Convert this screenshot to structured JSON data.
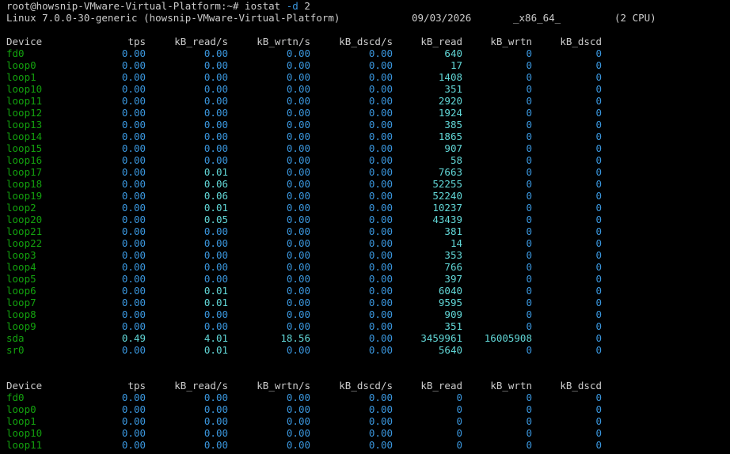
{
  "colors": {
    "background": "#000000",
    "text": "#cccccc",
    "device": "#13a10e",
    "value": "#3a96dd",
    "value_bright": "#61d6d6"
  },
  "prompt": {
    "user_host": "root@howsnip-VMware-Virtual-Platform",
    "path": ":~#",
    "command": "iostat",
    "option": "-d",
    "argument": "2"
  },
  "sysinfo": {
    "kernel": "Linux 7.0.0-30-generic (howsnip-VMware-Virtual-Platform)",
    "date": "09/03/2026",
    "arch": "_x86_64_",
    "cpus": "(2 CPU)"
  },
  "headers": [
    "Device",
    "tps",
    "kB_read/s",
    "kB_wrtn/s",
    "kB_dscd/s",
    "kB_read",
    "kB_wrtn",
    "kB_dscd"
  ],
  "report1": [
    [
      "fd0",
      "0.00",
      "0.00",
      "0.00",
      "0.00",
      "640",
      "0",
      "0"
    ],
    [
      "loop0",
      "0.00",
      "0.00",
      "0.00",
      "0.00",
      "17",
      "0",
      "0"
    ],
    [
      "loop1",
      "0.00",
      "0.00",
      "0.00",
      "0.00",
      "1408",
      "0",
      "0"
    ],
    [
      "loop10",
      "0.00",
      "0.00",
      "0.00",
      "0.00",
      "351",
      "0",
      "0"
    ],
    [
      "loop11",
      "0.00",
      "0.00",
      "0.00",
      "0.00",
      "2920",
      "0",
      "0"
    ],
    [
      "loop12",
      "0.00",
      "0.00",
      "0.00",
      "0.00",
      "1924",
      "0",
      "0"
    ],
    [
      "loop13",
      "0.00",
      "0.00",
      "0.00",
      "0.00",
      "385",
      "0",
      "0"
    ],
    [
      "loop14",
      "0.00",
      "0.00",
      "0.00",
      "0.00",
      "1865",
      "0",
      "0"
    ],
    [
      "loop15",
      "0.00",
      "0.00",
      "0.00",
      "0.00",
      "907",
      "0",
      "0"
    ],
    [
      "loop16",
      "0.00",
      "0.00",
      "0.00",
      "0.00",
      "58",
      "0",
      "0"
    ],
    [
      "loop17",
      "0.00",
      "0.01",
      "0.00",
      "0.00",
      "7663",
      "0",
      "0"
    ],
    [
      "loop18",
      "0.00",
      "0.06",
      "0.00",
      "0.00",
      "52255",
      "0",
      "0"
    ],
    [
      "loop19",
      "0.00",
      "0.06",
      "0.00",
      "0.00",
      "52240",
      "0",
      "0"
    ],
    [
      "loop2",
      "0.00",
      "0.01",
      "0.00",
      "0.00",
      "10237",
      "0",
      "0"
    ],
    [
      "loop20",
      "0.00",
      "0.05",
      "0.00",
      "0.00",
      "43439",
      "0",
      "0"
    ],
    [
      "loop21",
      "0.00",
      "0.00",
      "0.00",
      "0.00",
      "381",
      "0",
      "0"
    ],
    [
      "loop22",
      "0.00",
      "0.00",
      "0.00",
      "0.00",
      "14",
      "0",
      "0"
    ],
    [
      "loop3",
      "0.00",
      "0.00",
      "0.00",
      "0.00",
      "353",
      "0",
      "0"
    ],
    [
      "loop4",
      "0.00",
      "0.00",
      "0.00",
      "0.00",
      "766",
      "0",
      "0"
    ],
    [
      "loop5",
      "0.00",
      "0.00",
      "0.00",
      "0.00",
      "397",
      "0",
      "0"
    ],
    [
      "loop6",
      "0.00",
      "0.01",
      "0.00",
      "0.00",
      "6040",
      "0",
      "0"
    ],
    [
      "loop7",
      "0.00",
      "0.01",
      "0.00",
      "0.00",
      "9595",
      "0",
      "0"
    ],
    [
      "loop8",
      "0.00",
      "0.00",
      "0.00",
      "0.00",
      "909",
      "0",
      "0"
    ],
    [
      "loop9",
      "0.00",
      "0.00",
      "0.00",
      "0.00",
      "351",
      "0",
      "0"
    ],
    [
      "sda",
      "0.49",
      "4.01",
      "18.56",
      "0.00",
      "3459961",
      "16005908",
      "0"
    ],
    [
      "sr0",
      "0.00",
      "0.01",
      "0.00",
      "0.00",
      "5640",
      "0",
      "0"
    ]
  ],
  "report2": [
    [
      "fd0",
      "0.00",
      "0.00",
      "0.00",
      "0.00",
      "0",
      "0",
      "0"
    ],
    [
      "loop0",
      "0.00",
      "0.00",
      "0.00",
      "0.00",
      "0",
      "0",
      "0"
    ],
    [
      "loop1",
      "0.00",
      "0.00",
      "0.00",
      "0.00",
      "0",
      "0",
      "0"
    ],
    [
      "loop10",
      "0.00",
      "0.00",
      "0.00",
      "0.00",
      "0",
      "0",
      "0"
    ],
    [
      "loop11",
      "0.00",
      "0.00",
      "0.00",
      "0.00",
      "0",
      "0",
      "0"
    ]
  ]
}
